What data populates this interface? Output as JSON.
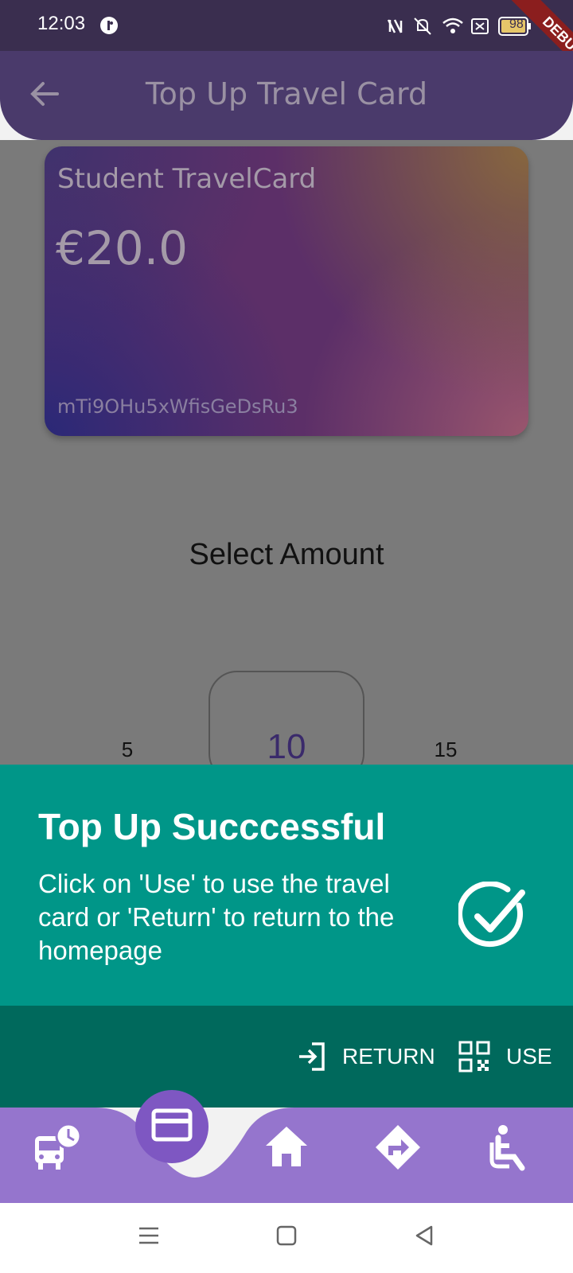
{
  "status_bar": {
    "time": "12:03",
    "battery": "98",
    "debug_banner": "DEBUG"
  },
  "app_bar": {
    "title": "Top Up Travel Card",
    "back_icon": "arrow-back-icon"
  },
  "card": {
    "name": "Student TravelCard",
    "balance": "€20.0",
    "id": "mTi9OHu5xWfisGeDsRu3"
  },
  "amount_picker": {
    "heading": "Select Amount",
    "left": "5",
    "selected": "10",
    "right": "15"
  },
  "snackbar": {
    "title": "Top Up Succcessful",
    "message": "Click on 'Use' to use the travel card or 'Return' to return to the homepage",
    "icon": "check-circle-icon",
    "return_label": "RETURN",
    "use_label": "USE",
    "colors": {
      "content": "#009688",
      "actions": "#00695c"
    }
  },
  "bottom_nav": {
    "items": [
      "bus-schedule-icon",
      "card-icon",
      "home-icon",
      "directions-icon",
      "accessibility-icon"
    ],
    "active": "card-icon",
    "colors": {
      "bar": "#9575cd",
      "active": "#7e57c2"
    }
  }
}
